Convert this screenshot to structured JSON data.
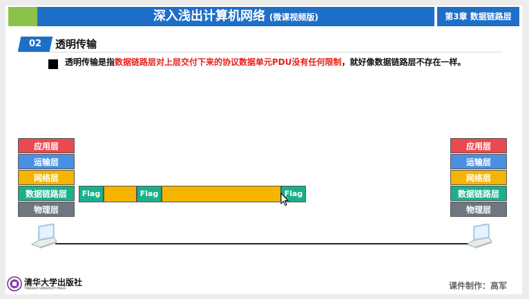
{
  "header": {
    "title": "深入浅出计算机网络",
    "subtitle": "(微课视频版)",
    "chapter": "第3章 数据链路层"
  },
  "section": {
    "number": "02",
    "title": "透明传输"
  },
  "description": {
    "prefix": "透明传输是指",
    "highlight": "数据链路层对上层交付下来的协议数据单元PDU没有任何限制",
    "suffix": "，就好像数据链路层不存在一样。"
  },
  "layers": [
    {
      "label": "应用层",
      "color": "#e84a4f"
    },
    {
      "label": "运输层",
      "color": "#4a90e2"
    },
    {
      "label": "网络层",
      "color": "#f4b400"
    },
    {
      "label": "数据链路层",
      "color": "#1ab08a"
    },
    {
      "label": "物理层",
      "color": "#6f7782"
    }
  ],
  "frame": {
    "flag_label": "Flag"
  },
  "footer": {
    "publisher": "清华大学出版社",
    "publisher_en": "TSINGHUA UNIVERSITY PRESS",
    "credit": "课件制作：高军"
  },
  "icons": [
    "laptop-icon",
    "publisher-seal-icon",
    "mouse-cursor-icon"
  ]
}
